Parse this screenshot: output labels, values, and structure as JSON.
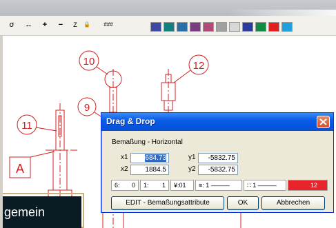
{
  "toolbar": {
    "tools": [
      {
        "icon": "sigma-icon",
        "glyph": "σ"
      },
      {
        "icon": "double-arrow-icon",
        "glyph": "↔"
      },
      {
        "icon": "plus-icon",
        "glyph": "+"
      },
      {
        "icon": "minus-icon",
        "glyph": "−"
      },
      {
        "icon": "zoom-icon",
        "glyph": "Z"
      },
      {
        "icon": "lock-icon",
        "glyph": "🔒"
      },
      {
        "icon": "grid-icon",
        "glyph": "###"
      }
    ],
    "swatches": [
      "#3b4aa0",
      "#138080",
      "#2a6fa8",
      "#7b3a82",
      "#b04a78",
      "#a0a0a0",
      "#d8d8d8",
      "#2a3d9c",
      "#148a40",
      "#e02020",
      "#1ea0e0"
    ]
  },
  "drawing": {
    "labels": [
      "10",
      "12",
      "9",
      "11",
      "A"
    ]
  },
  "background_label": "gemein",
  "dialog": {
    "title": "Drag & Drop",
    "subtitle": "Bemaßung - Horizontal",
    "x1_label": "x1",
    "x1_value": "684.73",
    "y1_label": "y1",
    "y1_value": "-5832.75",
    "x2_label": "x2",
    "x2_value": "1884.5",
    "y2_label": "y2",
    "y2_value": "-5832.75",
    "small_fields": [
      {
        "icon": "text-height-icon",
        "glyph": "6:",
        "value": "0"
      },
      {
        "icon": "line-style-icon",
        "glyph": "1:",
        "value": "1"
      },
      {
        "icon": "decimals-icon",
        "glyph": "¥:01",
        "value": ""
      },
      {
        "icon": "line-weight-icon",
        "glyph": "≡: 1 ———",
        "value": ""
      },
      {
        "icon": "line-type-icon",
        "glyph": "∷ 1 ———",
        "value": ""
      }
    ],
    "color_value": "12",
    "color_hex": "#e8232a",
    "edit_button": "EDIT - Bemaßungsattribute",
    "ok_button": "OK",
    "cancel_button": "Abbrechen"
  }
}
